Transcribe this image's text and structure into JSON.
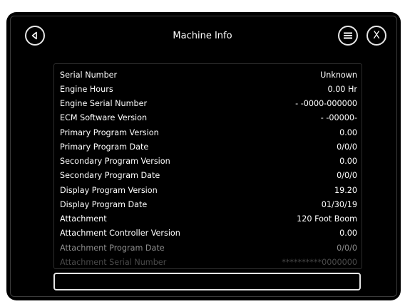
{
  "header": {
    "title": "Machine Info",
    "back_icon": "back-arrow-icon",
    "menu_icon": "menu-icon",
    "close_icon": "close-icon",
    "close_label": "X"
  },
  "rows": [
    {
      "label": "Serial Number",
      "value": "Unknown"
    },
    {
      "label": "Engine Hours",
      "value": "0.00 Hr"
    },
    {
      "label": "Engine Serial Number",
      "value": "- -0000-000000"
    },
    {
      "label": "ECM Software Version",
      "value": "- -00000-"
    },
    {
      "label": "Primary Program Version",
      "value": "0.00"
    },
    {
      "label": "Primary Program Date",
      "value": "0/0/0"
    },
    {
      "label": "Secondary Program Version",
      "value": "0.00"
    },
    {
      "label": "Secondary Program Date",
      "value": "0/0/0"
    },
    {
      "label": "Display Program Version",
      "value": "19.20"
    },
    {
      "label": "Display Program Date",
      "value": "01/30/19"
    },
    {
      "label": "Attachment",
      "value": "120 Foot Boom"
    },
    {
      "label": "Attachment Controller Version",
      "value": "0.00"
    },
    {
      "label": "Attachment Program Date",
      "value": "0/0/0"
    },
    {
      "label": "Attachment Serial Number",
      "value": "**********0000000"
    }
  ],
  "input": {
    "value": ""
  },
  "colors": {
    "background": "#000000",
    "text": "#ffffff",
    "faded_text": "#8d8d8d",
    "button_border": "#e6e6e6"
  }
}
